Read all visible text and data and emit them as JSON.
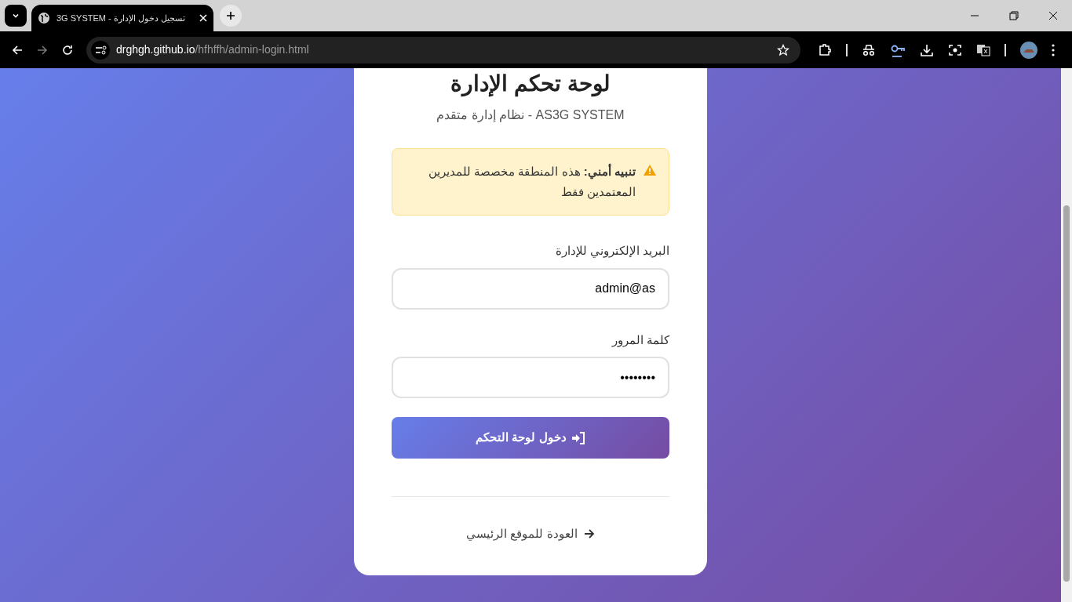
{
  "browser": {
    "tab_title": "تسجيل دخول الإدارة - 3G SYSTEM",
    "url_host": "drghgh.github.io",
    "url_path": "/hfhffh/admin-login.html"
  },
  "card": {
    "title": "لوحة تحكم الإدارة",
    "subtitle": "AS3G SYSTEM - نظام إدارة متقدم",
    "alert": {
      "text": "**تنبيه أمني:** هذه المنطقة مخصصة للمديرين المعتمدين فقط"
    },
    "fields": [
      {
        "label": "البريد الإلكتروني للإدارة",
        "value": "admin@as"
      },
      {
        "label": "كلمة المرور",
        "value": "••••••••"
      }
    ],
    "submit_button": "دخول لوحة التحكم",
    "back_link": "العودة للموقع الرئيسي"
  }
}
